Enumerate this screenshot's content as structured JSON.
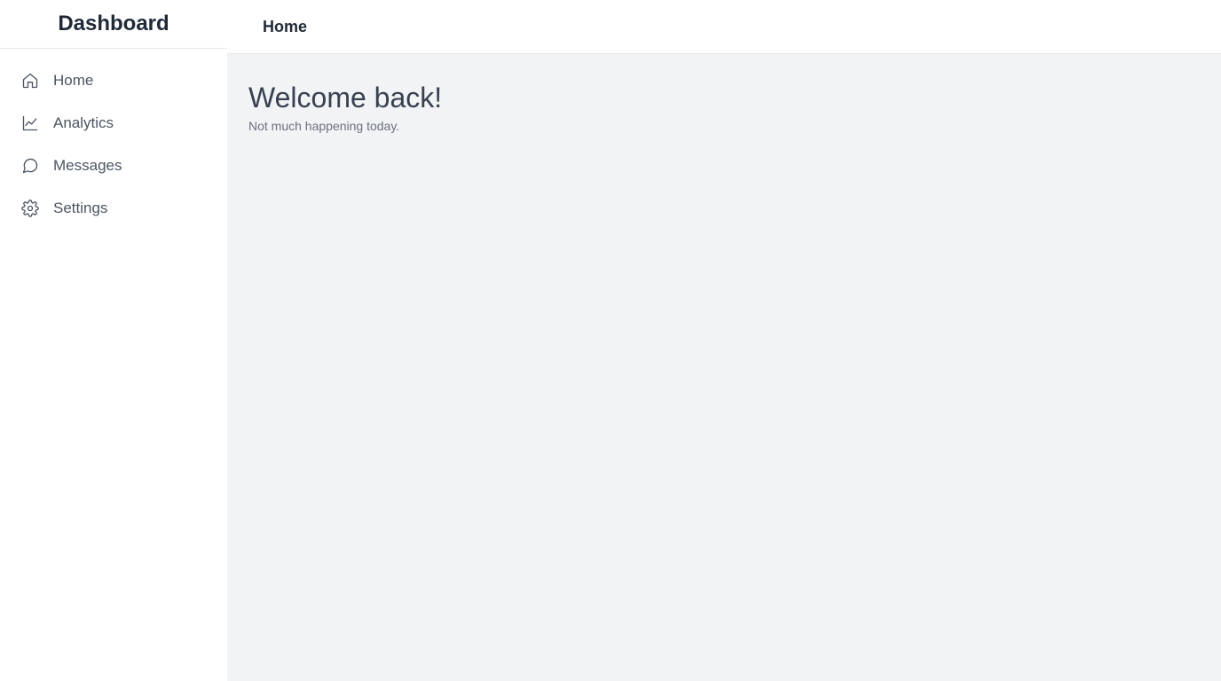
{
  "sidebar": {
    "brand": "Dashboard",
    "items": [
      {
        "label": "Home",
        "icon": "home-icon"
      },
      {
        "label": "Analytics",
        "icon": "chart-line-icon"
      },
      {
        "label": "Messages",
        "icon": "message-circle-icon"
      },
      {
        "label": "Settings",
        "icon": "gear-icon"
      }
    ]
  },
  "header": {
    "title": "Home"
  },
  "main": {
    "heading": "Welcome back!",
    "subtitle": "Not much happening today."
  },
  "colors": {
    "text_primary": "#1f2937",
    "text_secondary": "#4b5563",
    "content_background": "#f2f3f5",
    "border": "#e5e7eb"
  }
}
